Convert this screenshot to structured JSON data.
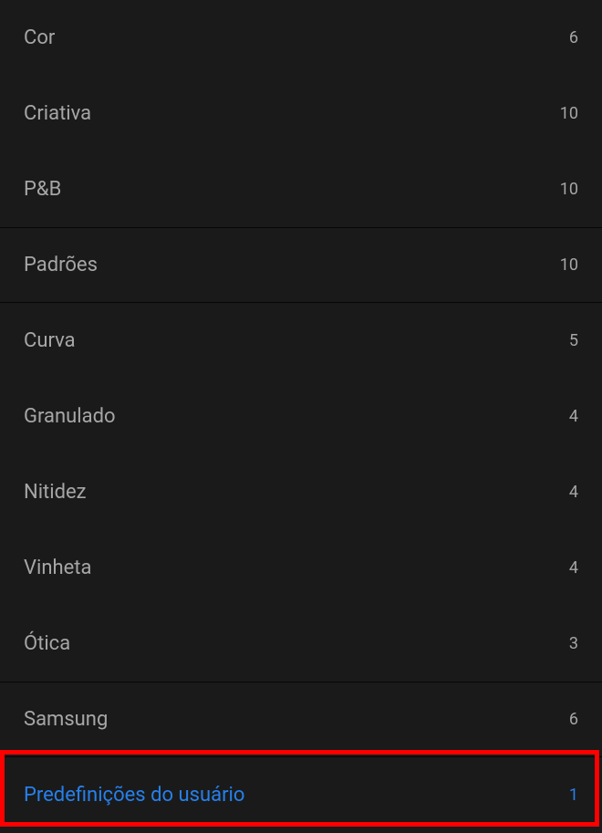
{
  "presets": {
    "items": [
      {
        "label": "Cor",
        "count": "6",
        "borderClass": "",
        "selected": false
      },
      {
        "label": "Criativa",
        "count": "10",
        "borderClass": "",
        "selected": false
      },
      {
        "label": "P&B",
        "count": "10",
        "borderClass": "",
        "selected": false
      },
      {
        "label": "Padrões",
        "count": "10",
        "borderClass": "with-border",
        "selected": false
      },
      {
        "label": "Curva",
        "count": "5",
        "borderClass": "",
        "selected": false
      },
      {
        "label": "Granulado",
        "count": "4",
        "borderClass": "",
        "selected": false
      },
      {
        "label": "Nitidez",
        "count": "4",
        "borderClass": "",
        "selected": false
      },
      {
        "label": "Vinheta",
        "count": "4",
        "borderClass": "",
        "selected": false
      },
      {
        "label": "Ótica",
        "count": "3",
        "borderClass": "",
        "selected": false
      },
      {
        "label": "Samsung",
        "count": "6",
        "borderClass": "with-border",
        "selected": false
      },
      {
        "label": "Predefinições do usuário",
        "count": "1",
        "borderClass": "",
        "selected": true
      }
    ]
  }
}
